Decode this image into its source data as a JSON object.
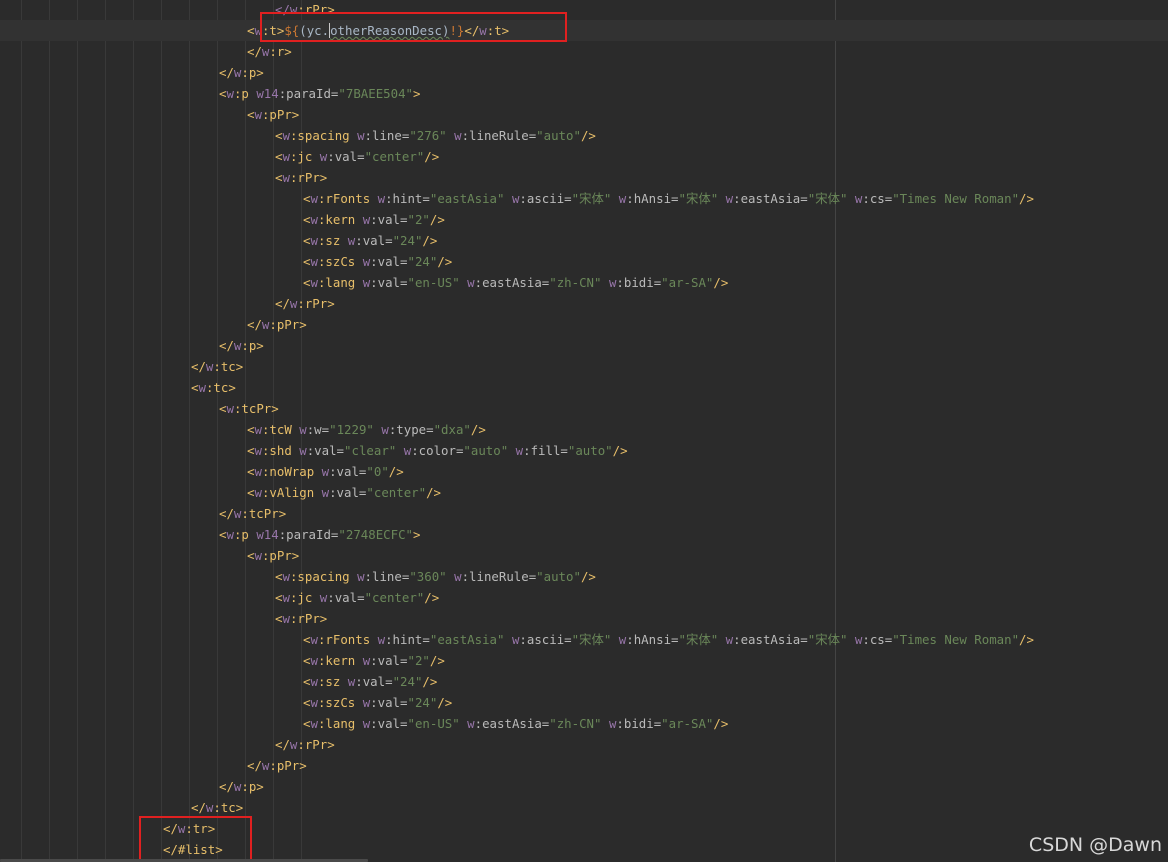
{
  "editor": {
    "lines": [
      [
        [
          "ns",
          "</"
        ],
        [
          "ns",
          "w"
        ],
        [
          "tag",
          ":rPr>"
        ]
      ],
      [
        [
          "tag",
          "<"
        ],
        [
          "ns",
          "w"
        ],
        [
          "tag",
          ":t>"
        ],
        [
          "ph",
          "${"
        ],
        [
          "text",
          "(yc."
        ],
        [
          "caret",
          ""
        ],
        [
          "text",
          "otherReasonDesc)"
        ],
        [
          "ph",
          "!}"
        ],
        [
          "tag",
          "</"
        ],
        [
          "ns",
          "w"
        ],
        [
          "tag",
          ":t>"
        ]
      ],
      [
        [
          "tag",
          "</"
        ],
        [
          "ns",
          "w"
        ],
        [
          "tag",
          ":r>"
        ]
      ],
      [
        [
          "tag",
          "</"
        ],
        [
          "ns",
          "w"
        ],
        [
          "tag",
          ":p>"
        ]
      ],
      [
        [
          "tag",
          "<"
        ],
        [
          "ns",
          "w"
        ],
        [
          "tag",
          ":p "
        ],
        [
          "ns",
          "w14"
        ],
        [
          "attr",
          ":paraId="
        ],
        [
          "val",
          "\"7BAEE504\""
        ],
        [
          "tag",
          ">"
        ]
      ],
      [
        [
          "tag",
          "<"
        ],
        [
          "ns",
          "w"
        ],
        [
          "tag",
          ":pPr>"
        ]
      ],
      [
        [
          "tag",
          "<"
        ],
        [
          "ns",
          "w"
        ],
        [
          "tag",
          ":spacing "
        ],
        [
          "ns",
          "w"
        ],
        [
          "attr",
          ":line="
        ],
        [
          "val",
          "\"276\""
        ],
        [
          "attr",
          " "
        ],
        [
          "ns",
          "w"
        ],
        [
          "attr",
          ":lineRule="
        ],
        [
          "val",
          "\"auto\""
        ],
        [
          "tag",
          "/>"
        ]
      ],
      [
        [
          "tag",
          "<"
        ],
        [
          "ns",
          "w"
        ],
        [
          "tag",
          ":jc "
        ],
        [
          "ns",
          "w"
        ],
        [
          "attr",
          ":val="
        ],
        [
          "val",
          "\"center\""
        ],
        [
          "tag",
          "/>"
        ]
      ],
      [
        [
          "tag",
          "<"
        ],
        [
          "ns",
          "w"
        ],
        [
          "tag",
          ":rPr>"
        ]
      ],
      [
        [
          "tag",
          "<"
        ],
        [
          "ns",
          "w"
        ],
        [
          "tag",
          ":rFonts "
        ],
        [
          "ns",
          "w"
        ],
        [
          "attr",
          ":hint="
        ],
        [
          "val",
          "\"eastAsia\""
        ],
        [
          "attr",
          " "
        ],
        [
          "ns",
          "w"
        ],
        [
          "attr",
          ":ascii="
        ],
        [
          "val",
          "\"宋体\""
        ],
        [
          "attr",
          " "
        ],
        [
          "ns",
          "w"
        ],
        [
          "attr",
          ":hAnsi="
        ],
        [
          "val",
          "\"宋体\""
        ],
        [
          "attr",
          " "
        ],
        [
          "ns",
          "w"
        ],
        [
          "attr",
          ":eastAsia="
        ],
        [
          "val",
          "\"宋体\""
        ],
        [
          "attr",
          " "
        ],
        [
          "ns",
          "w"
        ],
        [
          "attr",
          ":cs="
        ],
        [
          "val",
          "\"Times New Roman\""
        ],
        [
          "tag",
          "/>"
        ]
      ],
      [
        [
          "tag",
          "<"
        ],
        [
          "ns",
          "w"
        ],
        [
          "tag",
          ":kern "
        ],
        [
          "ns",
          "w"
        ],
        [
          "attr",
          ":val="
        ],
        [
          "val",
          "\"2\""
        ],
        [
          "tag",
          "/>"
        ]
      ],
      [
        [
          "tag",
          "<"
        ],
        [
          "ns",
          "w"
        ],
        [
          "tag",
          ":sz "
        ],
        [
          "ns",
          "w"
        ],
        [
          "attr",
          ":val="
        ],
        [
          "val",
          "\"24\""
        ],
        [
          "tag",
          "/>"
        ]
      ],
      [
        [
          "tag",
          "<"
        ],
        [
          "ns",
          "w"
        ],
        [
          "tag",
          ":szCs "
        ],
        [
          "ns",
          "w"
        ],
        [
          "attr",
          ":val="
        ],
        [
          "val",
          "\"24\""
        ],
        [
          "tag",
          "/>"
        ]
      ],
      [
        [
          "tag",
          "<"
        ],
        [
          "ns",
          "w"
        ],
        [
          "tag",
          ":lang "
        ],
        [
          "ns",
          "w"
        ],
        [
          "attr",
          ":val="
        ],
        [
          "val",
          "\"en-US\""
        ],
        [
          "attr",
          " "
        ],
        [
          "ns",
          "w"
        ],
        [
          "attr",
          ":eastAsia="
        ],
        [
          "val",
          "\"zh-CN\""
        ],
        [
          "attr",
          " "
        ],
        [
          "ns",
          "w"
        ],
        [
          "attr",
          ":bidi="
        ],
        [
          "val",
          "\"ar-SA\""
        ],
        [
          "tag",
          "/>"
        ]
      ],
      [
        [
          "tag",
          "</"
        ],
        [
          "ns",
          "w"
        ],
        [
          "tag",
          ":rPr>"
        ]
      ],
      [
        [
          "tag",
          "</"
        ],
        [
          "ns",
          "w"
        ],
        [
          "tag",
          ":pPr>"
        ]
      ],
      [
        [
          "tag",
          "</"
        ],
        [
          "ns",
          "w"
        ],
        [
          "tag",
          ":p>"
        ]
      ],
      [
        [
          "tag",
          "</"
        ],
        [
          "ns",
          "w"
        ],
        [
          "tag",
          ":tc>"
        ]
      ],
      [
        [
          "tag",
          "<"
        ],
        [
          "ns",
          "w"
        ],
        [
          "tag",
          ":tc>"
        ]
      ],
      [
        [
          "tag",
          "<"
        ],
        [
          "ns",
          "w"
        ],
        [
          "tag",
          ":tcPr>"
        ]
      ],
      [
        [
          "tag",
          "<"
        ],
        [
          "ns",
          "w"
        ],
        [
          "tag",
          ":tcW "
        ],
        [
          "ns",
          "w"
        ],
        [
          "attr",
          ":w="
        ],
        [
          "val",
          "\"1229\""
        ],
        [
          "attr",
          " "
        ],
        [
          "ns",
          "w"
        ],
        [
          "attr",
          ":type="
        ],
        [
          "val",
          "\"dxa\""
        ],
        [
          "tag",
          "/>"
        ]
      ],
      [
        [
          "tag",
          "<"
        ],
        [
          "ns",
          "w"
        ],
        [
          "tag",
          ":shd "
        ],
        [
          "ns",
          "w"
        ],
        [
          "attr",
          ":val="
        ],
        [
          "val",
          "\"clear\""
        ],
        [
          "attr",
          " "
        ],
        [
          "ns",
          "w"
        ],
        [
          "attr",
          ":color="
        ],
        [
          "val",
          "\"auto\""
        ],
        [
          "attr",
          " "
        ],
        [
          "ns",
          "w"
        ],
        [
          "attr",
          ":fill="
        ],
        [
          "val",
          "\"auto\""
        ],
        [
          "tag",
          "/>"
        ]
      ],
      [
        [
          "tag",
          "<"
        ],
        [
          "ns",
          "w"
        ],
        [
          "tag",
          ":noWrap "
        ],
        [
          "ns",
          "w"
        ],
        [
          "attr",
          ":val="
        ],
        [
          "val",
          "\"0\""
        ],
        [
          "tag",
          "/>"
        ]
      ],
      [
        [
          "tag",
          "<"
        ],
        [
          "ns",
          "w"
        ],
        [
          "tag",
          ":vAlign "
        ],
        [
          "ns",
          "w"
        ],
        [
          "attr",
          ":val="
        ],
        [
          "val",
          "\"center\""
        ],
        [
          "tag",
          "/>"
        ]
      ],
      [
        [
          "tag",
          "</"
        ],
        [
          "ns",
          "w"
        ],
        [
          "tag",
          ":tcPr>"
        ]
      ],
      [
        [
          "tag",
          "<"
        ],
        [
          "ns",
          "w"
        ],
        [
          "tag",
          ":p "
        ],
        [
          "ns",
          "w14"
        ],
        [
          "attr",
          ":paraId="
        ],
        [
          "val",
          "\"2748ECFC\""
        ],
        [
          "tag",
          ">"
        ]
      ],
      [
        [
          "tag",
          "<"
        ],
        [
          "ns",
          "w"
        ],
        [
          "tag",
          ":pPr>"
        ]
      ],
      [
        [
          "tag",
          "<"
        ],
        [
          "ns",
          "w"
        ],
        [
          "tag",
          ":spacing "
        ],
        [
          "ns",
          "w"
        ],
        [
          "attr",
          ":line="
        ],
        [
          "val",
          "\"360\""
        ],
        [
          "attr",
          " "
        ],
        [
          "ns",
          "w"
        ],
        [
          "attr",
          ":lineRule="
        ],
        [
          "val",
          "\"auto\""
        ],
        [
          "tag",
          "/>"
        ]
      ],
      [
        [
          "tag",
          "<"
        ],
        [
          "ns",
          "w"
        ],
        [
          "tag",
          ":jc "
        ],
        [
          "ns",
          "w"
        ],
        [
          "attr",
          ":val="
        ],
        [
          "val",
          "\"center\""
        ],
        [
          "tag",
          "/>"
        ]
      ],
      [
        [
          "tag",
          "<"
        ],
        [
          "ns",
          "w"
        ],
        [
          "tag",
          ":rPr>"
        ]
      ],
      [
        [
          "tag",
          "<"
        ],
        [
          "ns",
          "w"
        ],
        [
          "tag",
          ":rFonts "
        ],
        [
          "ns",
          "w"
        ],
        [
          "attr",
          ":hint="
        ],
        [
          "val",
          "\"eastAsia\""
        ],
        [
          "attr",
          " "
        ],
        [
          "ns",
          "w"
        ],
        [
          "attr",
          ":ascii="
        ],
        [
          "val",
          "\"宋体\""
        ],
        [
          "attr",
          " "
        ],
        [
          "ns",
          "w"
        ],
        [
          "attr",
          ":hAnsi="
        ],
        [
          "val",
          "\"宋体\""
        ],
        [
          "attr",
          " "
        ],
        [
          "ns",
          "w"
        ],
        [
          "attr",
          ":eastAsia="
        ],
        [
          "val",
          "\"宋体\""
        ],
        [
          "attr",
          " "
        ],
        [
          "ns",
          "w"
        ],
        [
          "attr",
          ":cs="
        ],
        [
          "val",
          "\"Times New Roman\""
        ],
        [
          "tag",
          "/>"
        ]
      ],
      [
        [
          "tag",
          "<"
        ],
        [
          "ns",
          "w"
        ],
        [
          "tag",
          ":kern "
        ],
        [
          "ns",
          "w"
        ],
        [
          "attr",
          ":val="
        ],
        [
          "val",
          "\"2\""
        ],
        [
          "tag",
          "/>"
        ]
      ],
      [
        [
          "tag",
          "<"
        ],
        [
          "ns",
          "w"
        ],
        [
          "tag",
          ":sz "
        ],
        [
          "ns",
          "w"
        ],
        [
          "attr",
          ":val="
        ],
        [
          "val",
          "\"24\""
        ],
        [
          "tag",
          "/>"
        ]
      ],
      [
        [
          "tag",
          "<"
        ],
        [
          "ns",
          "w"
        ],
        [
          "tag",
          ":szCs "
        ],
        [
          "ns",
          "w"
        ],
        [
          "attr",
          ":val="
        ],
        [
          "val",
          "\"24\""
        ],
        [
          "tag",
          "/>"
        ]
      ],
      [
        [
          "tag",
          "<"
        ],
        [
          "ns",
          "w"
        ],
        [
          "tag",
          ":lang "
        ],
        [
          "ns",
          "w"
        ],
        [
          "attr",
          ":val="
        ],
        [
          "val",
          "\"en-US\""
        ],
        [
          "attr",
          " "
        ],
        [
          "ns",
          "w"
        ],
        [
          "attr",
          ":eastAsia="
        ],
        [
          "val",
          "\"zh-CN\""
        ],
        [
          "attr",
          " "
        ],
        [
          "ns",
          "w"
        ],
        [
          "attr",
          ":bidi="
        ],
        [
          "val",
          "\"ar-SA\""
        ],
        [
          "tag",
          "/>"
        ]
      ],
      [
        [
          "tag",
          "</"
        ],
        [
          "ns",
          "w"
        ],
        [
          "tag",
          ":rPr>"
        ]
      ],
      [
        [
          "tag",
          "</"
        ],
        [
          "ns",
          "w"
        ],
        [
          "tag",
          ":pPr>"
        ]
      ],
      [
        [
          "tag",
          "</"
        ],
        [
          "ns",
          "w"
        ],
        [
          "tag",
          ":p>"
        ]
      ],
      [
        [
          "tag",
          "</"
        ],
        [
          "ns",
          "w"
        ],
        [
          "tag",
          ":tc>"
        ]
      ],
      [
        [
          "tag",
          "</"
        ],
        [
          "ns",
          "w"
        ],
        [
          "tag",
          ":tr>"
        ]
      ],
      [
        [
          "tag",
          "</#list>"
        ]
      ]
    ]
  },
  "watermark": "CSDN @Dawn"
}
